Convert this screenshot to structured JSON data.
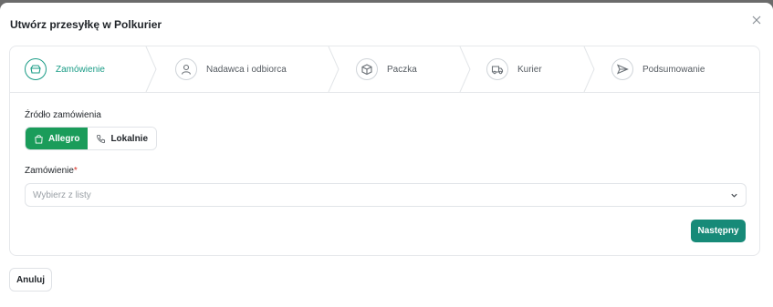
{
  "dialog": {
    "title": "Utwórz przesyłkę w Polkurier",
    "close_icon": "close-icon"
  },
  "steps": [
    {
      "label": "Zamówienie",
      "icon": "basket-icon",
      "active": true
    },
    {
      "label": "Nadawca i odbiorca",
      "icon": "user-icon",
      "active": false
    },
    {
      "label": "Paczka",
      "icon": "box-icon",
      "active": false
    },
    {
      "label": "Kurier",
      "icon": "truck-icon",
      "active": false
    },
    {
      "label": "Podsumowanie",
      "icon": "send-icon",
      "active": false
    }
  ],
  "source": {
    "label": "Źródło zamówienia",
    "options": [
      {
        "label": "Allegro",
        "icon": "bag-icon",
        "selected": true
      },
      {
        "label": "Lokalnie",
        "icon": "phone-icon",
        "selected": false
      }
    ]
  },
  "order": {
    "label": "Zamówienie",
    "required_mark": "*",
    "placeholder": "Wybierz z listy"
  },
  "actions": {
    "next": "Następny",
    "cancel": "Anuluj"
  },
  "colors": {
    "accent": "#1a9c86",
    "allegro_green": "#1a9c5a",
    "primary_button": "#178a78"
  }
}
